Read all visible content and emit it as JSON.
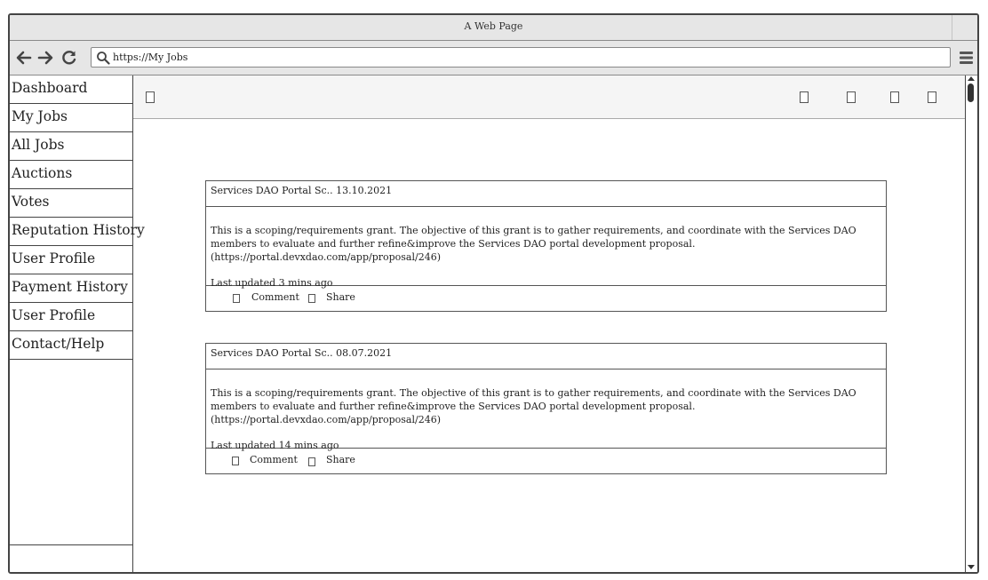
{
  "window": {
    "title": "A Web Page"
  },
  "browser": {
    "url": "https://My Jobs",
    "back_icon": "arrow-left-icon",
    "forward_icon": "arrow-right-icon",
    "reload_icon": "reload-icon",
    "search_icon": "search-icon",
    "menu_icon": "hamburger-icon"
  },
  "sidebar": {
    "items": [
      {
        "label": "Dashboard"
      },
      {
        "label": "My Jobs"
      },
      {
        "label": "All Jobs"
      },
      {
        "label": "Auctions"
      },
      {
        "label": "Votes"
      },
      {
        "label": "Reputation History"
      },
      {
        "label": "User Profile"
      },
      {
        "label": "Payment History"
      },
      {
        "label": "User Profile"
      },
      {
        "label": "Contact/Help"
      }
    ]
  },
  "posts": [
    {
      "header": "Services DAO Portal Sc.. 13.10.2021",
      "body": "This is a scoping/requirements grant. The objective of this grant is to gather requirements, and coordinate with the Services DAO members to evaluate and further refine&improve the Services DAO portal development proposal. (https://portal.devxdao.com/app/proposal/246)",
      "updated": "Last updated 3 mins ago",
      "comment_label": "Comment",
      "share_label": "Share"
    },
    {
      "header": "Services DAO Portal Sc.. 08.07.2021",
      "body": "This is a scoping/requirements grant. The objective of this grant is to gather requirements, and coordinate with the Services DAO members to evaluate and further refine&improve the Services DAO portal development proposal. (https://portal.devxdao.com/app/proposal/246)",
      "updated": "Last updated 14 mins ago",
      "comment_label": "Comment",
      "share_label": "Share"
    }
  ],
  "colors": {
    "chrome": "#e6e6e6",
    "border": "#444444",
    "topbar": "#f5f5f5"
  }
}
